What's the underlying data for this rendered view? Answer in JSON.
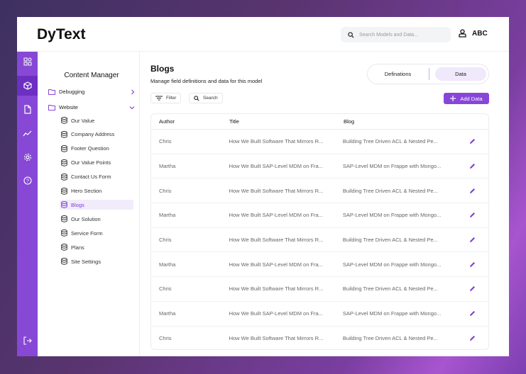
{
  "app": {
    "title": "DyText",
    "search_placeholder": "Search Models and Data...",
    "user": "ABC"
  },
  "rail": [
    "dashboard",
    "models",
    "documents",
    "analytics",
    "settings",
    "help",
    "logout"
  ],
  "content_manager": {
    "title": "Content Manager",
    "folders": [
      {
        "label": "Debugging",
        "expanded": false
      },
      {
        "label": "Website",
        "expanded": true
      }
    ],
    "items": [
      "Our Value",
      "Company Address",
      "Footer Question",
      "Our Value Points",
      "Contact Us Form",
      "Hero Section",
      "Blogs",
      "Our Solution",
      "Service Form",
      "Plans",
      "Site Settings"
    ],
    "active": "Blogs"
  },
  "main": {
    "title": "Blogs",
    "subtitle": "Manage field definitions and data for this model",
    "tabs": [
      "Definations",
      "Data"
    ],
    "active_tab": "Data",
    "filter_label": "Filter",
    "search_label": "Search",
    "add_label": "Add Data",
    "columns": [
      "Author",
      "Title",
      "Blog"
    ],
    "rows": [
      [
        "Chris",
        "How We Built Software That Mirrors R...",
        "Building Tree Driven ACL & Nested Pe..."
      ],
      [
        "Martha",
        "How We Built SAP-Level MDM on Fra...",
        "SAP-Level MDM on Frappe with Mongo..."
      ],
      [
        "Chris",
        "How We Built Software That Mirrors R...",
        "Building Tree Driven ACL & Nested Pe..."
      ],
      [
        "Martha",
        "How We Built SAP-Level MDM on Fra...",
        "SAP-Level MDM on Frappe with Mongo..."
      ],
      [
        "Chris",
        "How We Built Software That Mirrors R...",
        "Building Tree Driven ACL & Nested Pe..."
      ],
      [
        "Martha",
        "How We Built SAP-Level MDM on Fra...",
        "SAP-Level MDM on Frappe with Mongo..."
      ],
      [
        "Chris",
        "How We Built Software That Mirrors R...",
        "Building Tree Driven ACL & Nested Pe..."
      ],
      [
        "Martha",
        "How We Built SAP-Level MDM on Fra...",
        "SAP-Level MDM on Frappe with Mongo..."
      ],
      [
        "Chris",
        "How We Built Software That Mirrors R...",
        "Building Tree Driven ACL & Nested Pe..."
      ]
    ]
  },
  "colors": {
    "accent": "#8846d8",
    "rail": "#8748d6"
  }
}
